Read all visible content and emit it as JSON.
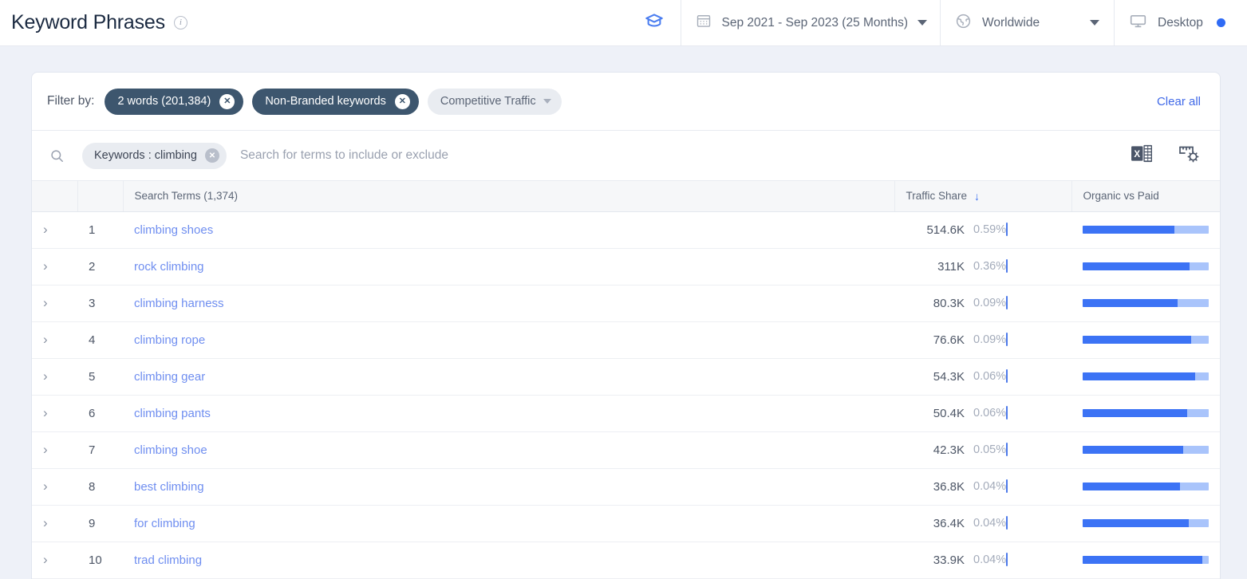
{
  "header": {
    "title": "Keyword Phrases",
    "info_icon": "info-icon",
    "academy_icon": "graduation-cap-icon",
    "date_range": "Sep 2021 - Sep 2023 (25 Months)",
    "geo": "Worldwide",
    "device": "Desktop"
  },
  "filters": {
    "label": "Filter by:",
    "chips": [
      {
        "label": "2 words (201,384)",
        "active": true
      },
      {
        "label": "Non-Branded keywords",
        "active": true
      }
    ],
    "dropdown": "Competitive Traffic",
    "clear_all": "Clear all"
  },
  "search": {
    "chip": "Keywords : climbing",
    "placeholder": "Search for terms to include or exclude",
    "export_icon": "excel-export-icon",
    "settings_icon": "table-settings-icon"
  },
  "table": {
    "columns": {
      "expand": "",
      "rank": "",
      "terms": "Search Terms (1,374)",
      "traffic_share": "Traffic Share",
      "sort_indicator": "↓",
      "organic_vs_paid": "Organic vs Paid"
    },
    "rows": [
      {
        "rank": "1",
        "term": "climbing shoes",
        "volume": "514.6K",
        "share": "0.59%",
        "share_fill_pct": 4,
        "organic_pct": 73,
        "paid_pct": 27
      },
      {
        "rank": "2",
        "term": "rock climbing",
        "volume": "311K",
        "share": "0.36%",
        "share_fill_pct": 3,
        "organic_pct": 85,
        "paid_pct": 15
      },
      {
        "rank": "3",
        "term": "climbing harness",
        "volume": "80.3K",
        "share": "0.09%",
        "share_fill_pct": 2.5,
        "organic_pct": 75,
        "paid_pct": 25
      },
      {
        "rank": "4",
        "term": "climbing rope",
        "volume": "76.6K",
        "share": "0.09%",
        "share_fill_pct": 2.5,
        "organic_pct": 86,
        "paid_pct": 14
      },
      {
        "rank": "5",
        "term": "climbing gear",
        "volume": "54.3K",
        "share": "0.06%",
        "share_fill_pct": 2,
        "organic_pct": 89,
        "paid_pct": 11
      },
      {
        "rank": "6",
        "term": "climbing pants",
        "volume": "50.4K",
        "share": "0.06%",
        "share_fill_pct": 2,
        "organic_pct": 83,
        "paid_pct": 17
      },
      {
        "rank": "7",
        "term": "climbing shoe",
        "volume": "42.3K",
        "share": "0.05%",
        "share_fill_pct": 2,
        "organic_pct": 80,
        "paid_pct": 20
      },
      {
        "rank": "8",
        "term": "best climbing",
        "volume": "36.8K",
        "share": "0.04%",
        "share_fill_pct": 2,
        "organic_pct": 77,
        "paid_pct": 23
      },
      {
        "rank": "9",
        "term": "for climbing",
        "volume": "36.4K",
        "share": "0.04%",
        "share_fill_pct": 2,
        "organic_pct": 84,
        "paid_pct": 16
      },
      {
        "rank": "10",
        "term": "trad climbing",
        "volume": "33.9K",
        "share": "0.04%",
        "share_fill_pct": 2,
        "organic_pct": 95,
        "paid_pct": 5
      }
    ]
  },
  "colors": {
    "accent": "#3c73f5",
    "accent_light": "#a9c4fb",
    "chip_dark": "#3d566e",
    "link": "#6f8ef0",
    "page_bg": "#eef1f8"
  }
}
